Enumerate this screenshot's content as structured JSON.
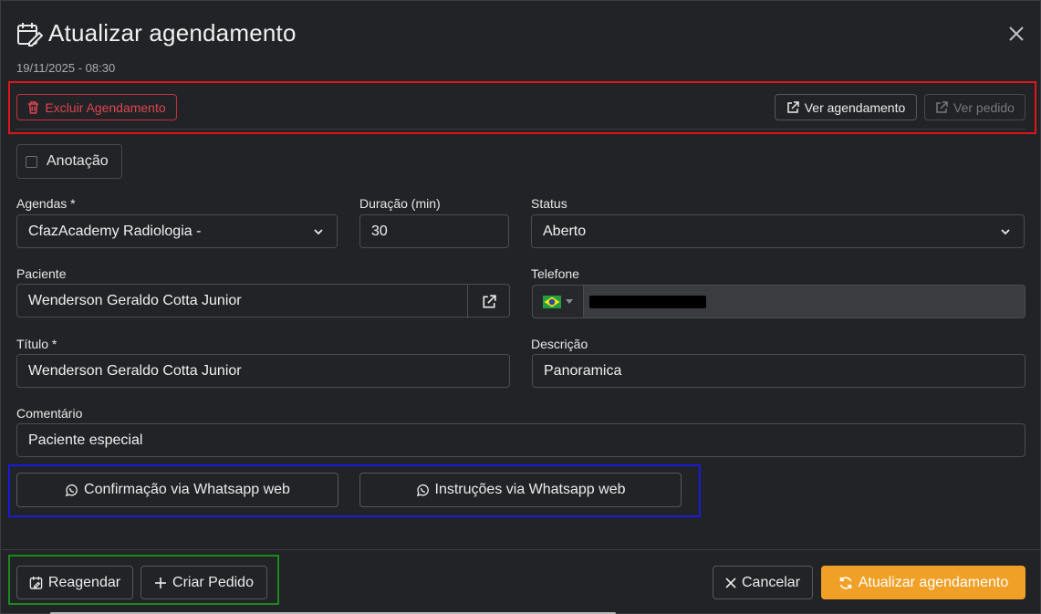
{
  "header": {
    "title": "Atualizar agendamento",
    "datetime": "19/11/2025 - 08:30"
  },
  "toolbar": {
    "delete_label": "Excluir Agendamento",
    "view_appointment_label": "Ver agendamento",
    "view_order_label": "Ver pedido"
  },
  "annotation": {
    "label": "Anotação",
    "checked": false
  },
  "form": {
    "agendas": {
      "label": "Agendas *",
      "value": "CfazAcademy Radiologia -"
    },
    "duracao": {
      "label": "Duração (min)",
      "value": "30"
    },
    "status": {
      "label": "Status",
      "value": "Aberto"
    },
    "paciente": {
      "label": "Paciente",
      "value": "Wenderson Geraldo Cotta Junior"
    },
    "telefone": {
      "label": "Telefone"
    },
    "titulo": {
      "label": "Título *",
      "value": "Wenderson Geraldo Cotta Junior"
    },
    "descricao": {
      "label": "Descrição",
      "value": "Panoramica"
    },
    "comentario": {
      "label": "Comentário",
      "value": "Paciente especial"
    }
  },
  "whatsapp": {
    "confirm_label": "Confirmação via Whatsapp web",
    "instructions_label": "Instruções via Whatsapp web"
  },
  "footer": {
    "reschedule_label": "Reagendar",
    "create_order_label": "Criar Pedido",
    "cancel_label": "Cancelar",
    "update_label": "Atualizar agendamento"
  },
  "colors": {
    "background": "#212327",
    "accent": "#f0a026",
    "danger": "#e0454f",
    "highlight_red": "#e0141c",
    "highlight_blue": "#1a1ad8",
    "highlight_green": "#1b8a1b"
  }
}
